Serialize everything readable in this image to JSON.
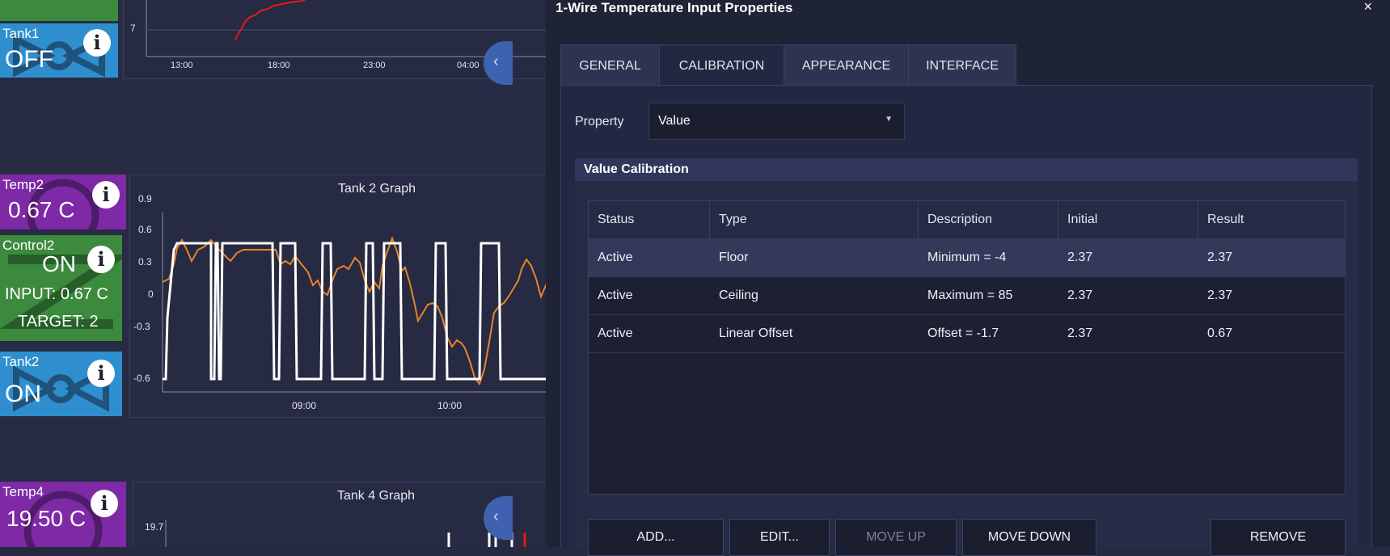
{
  "tiles": {
    "tank1": {
      "label": "Tank1",
      "value": "OFF",
      "color": "#2f8fce"
    },
    "temp2": {
      "label": "Temp2",
      "value": "0.67 C",
      "color": "#7e2aa6"
    },
    "control2": {
      "label": "Control2",
      "value": "ON",
      "input": "INPUT: 0.67 C",
      "target": "TARGET: 2",
      "color": "#3b8a3e"
    },
    "tank2": {
      "label": "Tank2",
      "value": "ON",
      "color": "#2f8fce"
    },
    "temp4": {
      "label": "Temp4",
      "value": "19.50 C",
      "color": "#7e2aa6"
    }
  },
  "top_graph": {
    "y_tick": "7",
    "x_ticks": [
      "13:00",
      "18:00",
      "23:00",
      "04:00"
    ]
  },
  "tank2_graph": {
    "title": "Tank 2 Graph",
    "y_ticks": [
      "0.9",
      "0.6",
      "0.3",
      "0",
      "-0.3",
      "-0.6"
    ],
    "x_ticks": [
      "09:00",
      "10:00"
    ],
    "series_colors": {
      "control": "#ffffff",
      "temperature": "#e8842a"
    }
  },
  "tank4_graph": {
    "title": "Tank 4 Graph",
    "y_ticks": [
      "19.7"
    ]
  },
  "dialog": {
    "title": "1-Wire Temperature Input Properties",
    "close": "×",
    "tabs": [
      "GENERAL",
      "CALIBRATION",
      "APPEARANCE",
      "INTERFACE"
    ],
    "active_tab": "CALIBRATION",
    "property_label": "Property",
    "property_value": "Value",
    "section_title": "Value Calibration",
    "columns": [
      "Status",
      "Type",
      "Description",
      "Initial",
      "Result"
    ],
    "rows": [
      {
        "status": "Active",
        "type": "Floor",
        "description": "Minimum = -4",
        "initial": "2.37",
        "result": "2.37"
      },
      {
        "status": "Active",
        "type": "Ceiling",
        "description": "Maximum = 85",
        "initial": "2.37",
        "result": "2.37"
      },
      {
        "status": "Active",
        "type": "Linear Offset",
        "description": "Offset = -1.7",
        "initial": "2.37",
        "result": "0.67"
      }
    ],
    "buttons": {
      "add": "ADD...",
      "edit": "EDIT...",
      "move_up": "MOVE UP",
      "move_down": "MOVE DOWN",
      "remove": "REMOVE"
    }
  }
}
